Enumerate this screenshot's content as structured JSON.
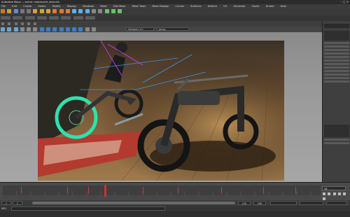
{
  "window": {
    "title": "Autodesk Maya — scene: motorcycle_shot.mb"
  },
  "menu": [
    "File",
    "Edit",
    "Create",
    "Select",
    "Modify",
    "Display",
    "Windows",
    "Mesh",
    "Edit Mesh",
    "Mesh Tools",
    "Mesh Display",
    "Curves",
    "Surfaces",
    "Deform",
    "UV",
    "Generate",
    "Cache",
    "Arnold",
    "Help"
  ],
  "panel": {
    "renderer_dropdown": "Viewport 2.0",
    "camera_dropdown": "persp"
  },
  "timeline": {
    "current_frame": "33",
    "playhead_fraction": 0.32
  },
  "range": {
    "start": "1",
    "end": "120",
    "anim_start": "1",
    "anim_end": "200"
  },
  "command_line": {
    "label": "MEL"
  },
  "colors": {
    "accent": "#2fa0d8",
    "playhead": "#cc3333",
    "ui_dark": "#3c3c3c"
  }
}
